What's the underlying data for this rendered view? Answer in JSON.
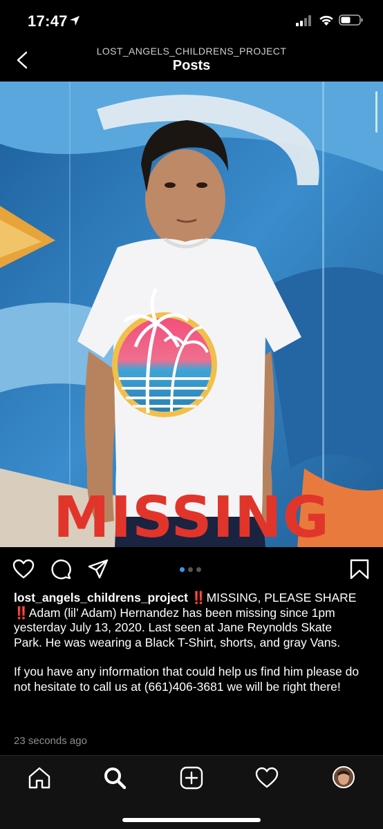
{
  "status_bar": {
    "time": "17:47",
    "icons": [
      "location-arrow-icon",
      "cellular-signal-icon",
      "wifi-icon",
      "battery-icon"
    ]
  },
  "header": {
    "account": "LOST_ANGELS_CHILDRENS_PROJECT",
    "title": "Posts",
    "back_icon": "chevron-left-icon"
  },
  "post": {
    "image_overlay_text": "MISSING",
    "carousel": {
      "count": 3,
      "active_index": 0
    },
    "actions": [
      "heart-icon",
      "comment-icon",
      "share-icon",
      "bookmark-icon"
    ],
    "caption": {
      "username": "lost_angels_childrens_project",
      "alert_1": "‼️",
      "text_1": "MISSING, PLEASE SHARE ",
      "alert_2": "‼️",
      "text_2": "Adam (lil’ Adam) Hernandez has been missing since 1pm yesterday July 13, 2020. Last seen at Jane Reynolds Skate Park. He was wearing a Black T-Shirt, shorts, and gray Vans.",
      "paragraph_2": "If you have any information that could help us find him please do not hesitate to call us at (661)406-3681 we will be right there!"
    },
    "timestamp": "23 seconds ago"
  },
  "tab_bar": {
    "items": [
      "home-icon",
      "search-icon",
      "new-post-icon",
      "activity-heart-icon",
      "profile-avatar"
    ],
    "active": "search-icon"
  },
  "colors": {
    "background": "#000000",
    "missing_red": "#e1352b",
    "carousel_active": "#3897f0",
    "timestamp_gray": "#8e8e8e"
  }
}
